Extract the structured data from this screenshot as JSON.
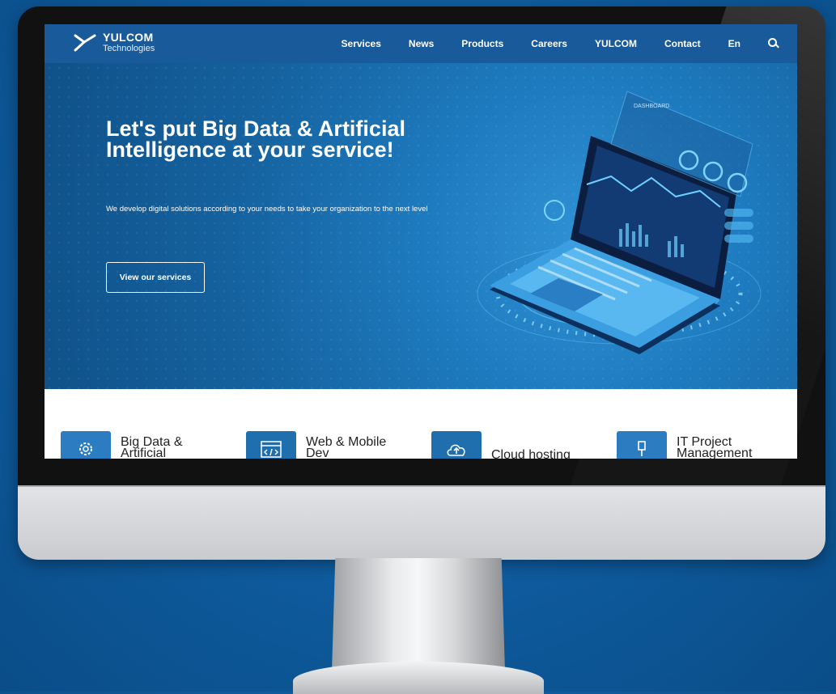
{
  "header": {
    "logo_name": "YULCOM",
    "logo_sub": "Technologies",
    "nav": [
      "Services",
      "News",
      "Products",
      "Careers",
      "YULCOM",
      "Contact",
      "En"
    ]
  },
  "hero": {
    "title": "Let's put Big Data & Artificial Intelligence at your service!",
    "subtitle": "We develop digital solutions according to your needs to take your organization to the next level",
    "cta": "View our services",
    "dashboard_label": "DASHBOARD"
  },
  "services": [
    {
      "label": "Big Data & Artificial",
      "icon": "brain-gear-icon"
    },
    {
      "label": "Web & Mobile Dev",
      "icon": "code-window-icon"
    },
    {
      "label": "Cloud hosting",
      "icon": "cloud-upload-icon"
    },
    {
      "label": "IT Project Management",
      "icon": "project-icon"
    }
  ],
  "colors": {
    "nav_bg": "#185a9a",
    "hero_bg": "#1e7bbf",
    "service_icon_bg": "#2b7cc0",
    "page_bg": "#0e5a9c"
  }
}
